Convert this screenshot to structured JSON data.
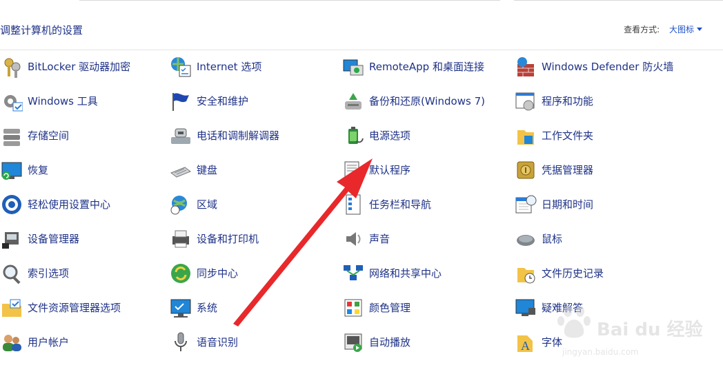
{
  "header": {
    "title": "调整计算机的设置",
    "view_by_label": "查看方式:",
    "view_by_value": "大图标"
  },
  "columns": [
    [
      {
        "label": "BitLocker 驱动器加密",
        "icon": "bitlocker-keys-icon"
      },
      {
        "label": "Windows 工具",
        "icon": "gear-tools-icon"
      },
      {
        "label": "存储空间",
        "icon": "storage-drives-icon"
      },
      {
        "label": "恢复",
        "icon": "recovery-monitor-icon"
      },
      {
        "label": "轻松使用设置中心",
        "icon": "ease-of-access-icon"
      },
      {
        "label": "设备管理器",
        "icon": "device-manager-icon"
      },
      {
        "label": "索引选项",
        "icon": "indexing-magnifier-icon"
      },
      {
        "label": "文件资源管理器选项",
        "icon": "folder-options-icon"
      },
      {
        "label": "用户帐户",
        "icon": "user-accounts-icon"
      }
    ],
    [
      {
        "label": "Internet 选项",
        "icon": "globe-checklist-icon"
      },
      {
        "label": "安全和维护",
        "icon": "flag-icon"
      },
      {
        "label": "电话和调制解调器",
        "icon": "phone-modem-icon"
      },
      {
        "label": "键盘",
        "icon": "keyboard-icon"
      },
      {
        "label": "区域",
        "icon": "globe-clock-icon"
      },
      {
        "label": "设备和打印机",
        "icon": "printer-icon"
      },
      {
        "label": "同步中心",
        "icon": "sync-icon"
      },
      {
        "label": "系统",
        "icon": "system-monitor-icon"
      },
      {
        "label": "语音识别",
        "icon": "microphone-icon"
      }
    ],
    [
      {
        "label": "RemoteApp 和桌面连接",
        "icon": "remoteapp-icon"
      },
      {
        "label": "备份和还原(Windows 7)",
        "icon": "backup-restore-icon"
      },
      {
        "label": "电源选项",
        "icon": "battery-plug-icon"
      },
      {
        "label": "默认程序",
        "icon": "default-programs-icon"
      },
      {
        "label": "任务栏和导航",
        "icon": "taskbar-icon"
      },
      {
        "label": "声音",
        "icon": "speaker-icon"
      },
      {
        "label": "网络和共享中心",
        "icon": "network-icon"
      },
      {
        "label": "颜色管理",
        "icon": "color-management-icon"
      },
      {
        "label": "自动播放",
        "icon": "autoplay-icon"
      }
    ],
    [
      {
        "label": "Windows Defender 防火墙",
        "icon": "firewall-icon"
      },
      {
        "label": "程序和功能",
        "icon": "programs-features-icon"
      },
      {
        "label": "工作文件夹",
        "icon": "work-folders-icon"
      },
      {
        "label": "凭据管理器",
        "icon": "credential-vault-icon"
      },
      {
        "label": "日期和时间",
        "icon": "calendar-clock-icon"
      },
      {
        "label": "鼠标",
        "icon": "mouse-icon"
      },
      {
        "label": "文件历史记录",
        "icon": "file-history-icon"
      },
      {
        "label": "疑难解答",
        "icon": "troubleshooting-icon"
      },
      {
        "label": "字体",
        "icon": "fonts-icon"
      }
    ]
  ],
  "colors": {
    "link": "#1e3287",
    "accent": "#1e50c8",
    "annotation_arrow": "#e8282b"
  },
  "watermark": {
    "brand": "Bai du 经验",
    "url": "jingyan.baidu.com"
  }
}
